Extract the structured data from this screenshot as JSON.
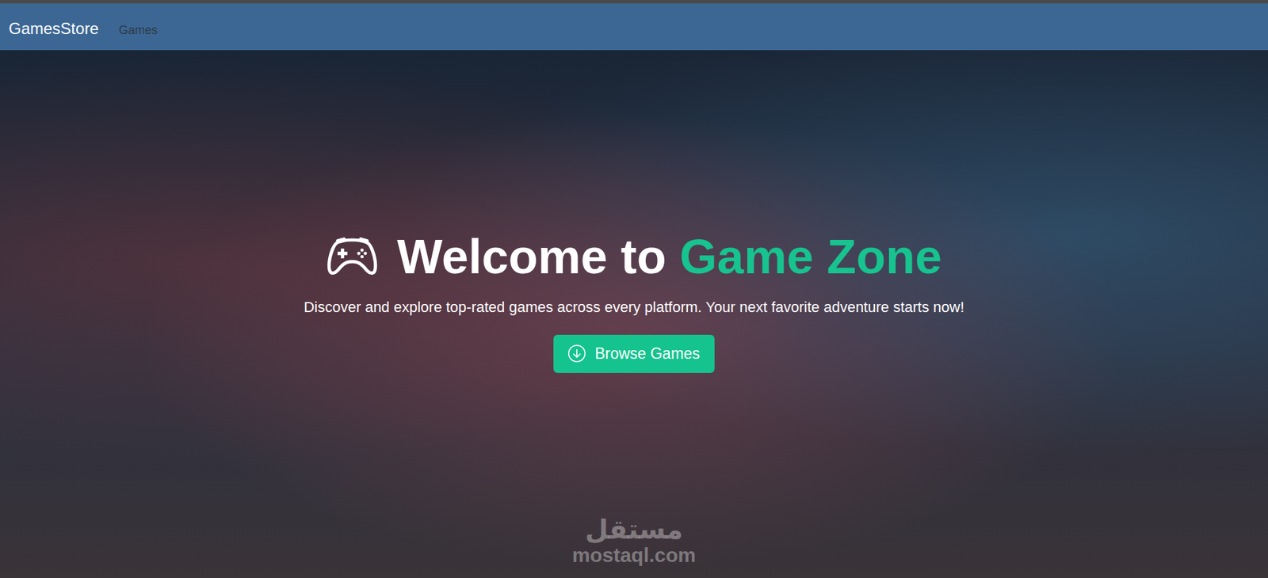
{
  "navbar": {
    "brand": "GamesStore",
    "links": [
      {
        "label": "Games",
        "selected": false
      }
    ]
  },
  "hero": {
    "title": {
      "lead": "Welcome to",
      "highlight": "Game Zone"
    },
    "subtitle": "Discover and explore top-rated games across every platform. Your next favorite adventure starts now!",
    "button": {
      "label": "Browse Games"
    }
  },
  "watermark": {
    "logo": "مستقل",
    "domain": "mostaql.com"
  }
}
